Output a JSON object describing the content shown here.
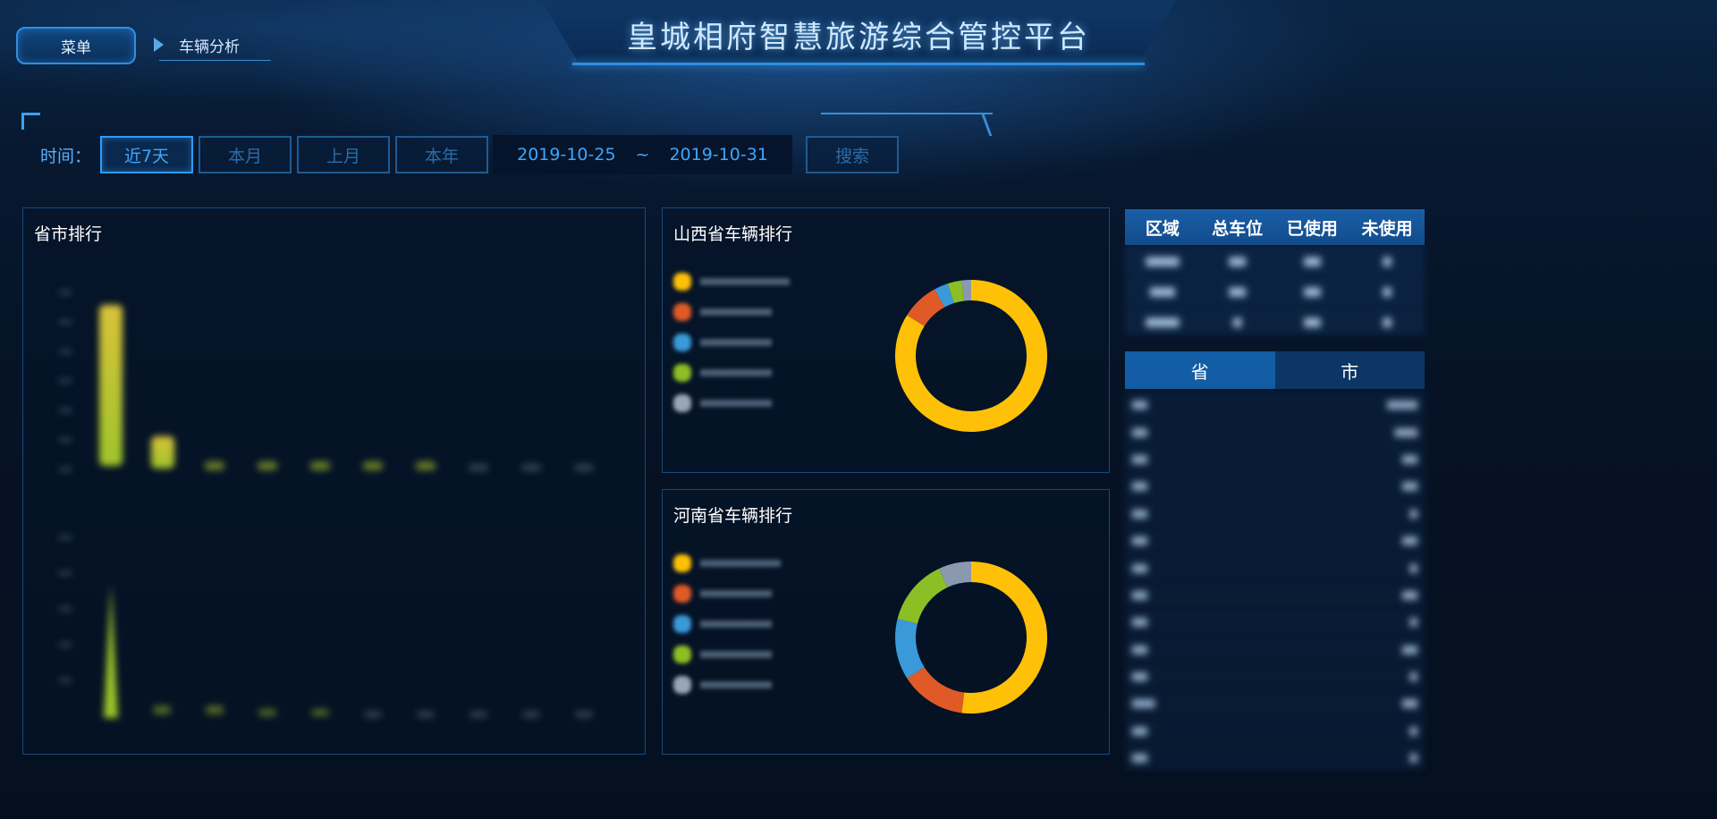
{
  "header": {
    "title": "皇城相府智慧旅游综合管控平台",
    "menu_label": "菜单",
    "breadcrumb": "车辆分析"
  },
  "filters": {
    "time_label": "时间：",
    "ranges": [
      "近7天",
      "本月",
      "上月",
      "本年"
    ],
    "active_range": "近7天",
    "date_start": "2019-10-25",
    "date_sep": "~",
    "date_end": "2019-10-31",
    "search_label": "搜索"
  },
  "panels": {
    "ranking": {
      "title": "省市排行"
    },
    "shanxi": {
      "title": "山西省车辆排行"
    },
    "henan": {
      "title": "河南省车辆排行"
    }
  },
  "table": {
    "headers": [
      "区域",
      "总车位",
      "已使用",
      "未使用"
    ]
  },
  "region_tabs": [
    "省",
    "市"
  ],
  "colors": {
    "yellow": "#ffc107",
    "orange": "#e05a28",
    "blue": "#3a9ad9",
    "green": "#8cbf26",
    "gray": "#8a99ad",
    "accent": "#3ea6ff"
  },
  "chart_data": [
    {
      "type": "pie",
      "name_key": "shanxi",
      "slices": [
        {
          "color": "yellow",
          "value": 84
        },
        {
          "color": "orange",
          "value": 8
        },
        {
          "color": "blue",
          "value": 3
        },
        {
          "color": "green",
          "value": 3
        },
        {
          "color": "gray",
          "value": 2
        }
      ]
    },
    {
      "type": "pie",
      "name_key": "henan",
      "slices": [
        {
          "color": "yellow",
          "value": 52
        },
        {
          "color": "orange",
          "value": 14
        },
        {
          "color": "blue",
          "value": 13
        },
        {
          "color": "green",
          "value": 14
        },
        {
          "color": "gray",
          "value": 7
        }
      ]
    }
  ]
}
